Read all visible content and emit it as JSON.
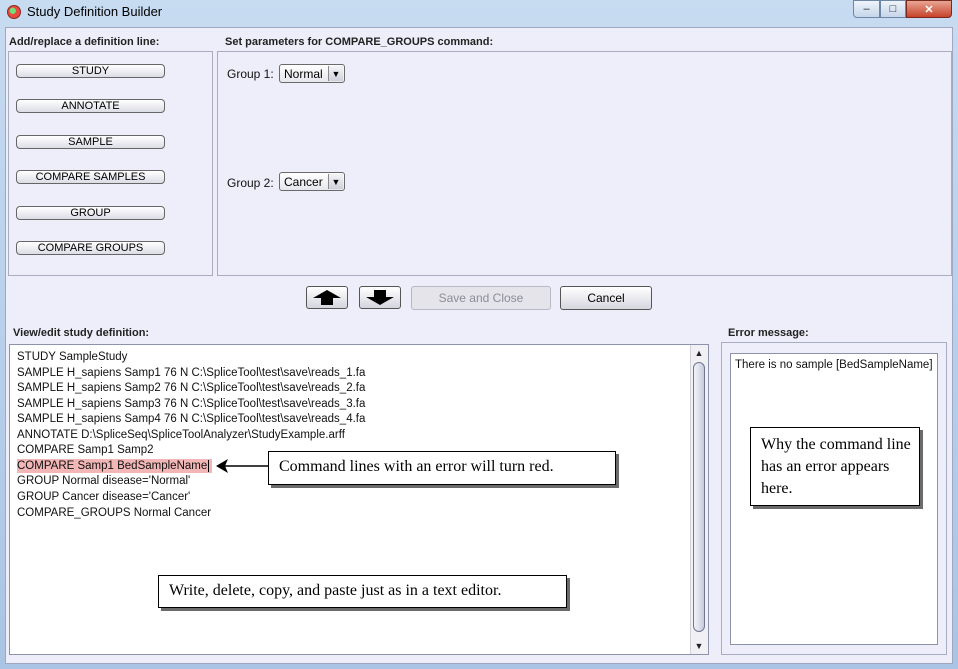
{
  "window": {
    "title": "Study Definition Builder",
    "controls": {
      "minimize": "‒",
      "maximize": "□",
      "close": "✕"
    }
  },
  "left_panel": {
    "label": "Add/replace a definition line:",
    "buttons": [
      "STUDY",
      "ANNOTATE",
      "SAMPLE",
      "COMPARE SAMPLES",
      "GROUP",
      "COMPARE GROUPS"
    ]
  },
  "params_panel": {
    "label": "Set parameters for COMPARE_GROUPS command:",
    "group1": {
      "label": "Group 1:",
      "value": "Normal"
    },
    "group2": {
      "label": "Group 2:",
      "value": "Cancer"
    }
  },
  "actions": {
    "move_up": "up-arrow",
    "move_down": "down-arrow",
    "save_label": "Save and Close",
    "save_enabled": false,
    "cancel_label": "Cancel"
  },
  "editor": {
    "label": "View/edit study definition:",
    "lines": [
      "STUDY SampleStudy",
      "SAMPLE H_sapiens Samp1 76 N C:\\SpliceTool\\test\\save\\reads_1.fa",
      "SAMPLE H_sapiens Samp2 76 N C:\\SpliceTool\\test\\save\\reads_2.fa",
      "SAMPLE H_sapiens Samp3 76 N C:\\SpliceTool\\test\\save\\reads_3.fa",
      "SAMPLE H_sapiens Samp4 76 N C:\\SpliceTool\\test\\save\\reads_4.fa",
      "ANNOTATE D:\\SpliceSeq\\SpliceToolAnalyzer\\StudyExample.arff",
      "COMPARE Samp1 Samp2",
      "COMPARE Samp1 BedSampleName",
      "GROUP Normal disease='Normal'",
      "GROUP Cancer disease='Cancer'",
      "COMPARE_GROUPS Normal Cancer"
    ],
    "error_line_index": 7,
    "error_color": "#f2b6b6"
  },
  "error_panel": {
    "label": "Error message:",
    "message": "There is no sample [BedSampleName]"
  },
  "callouts": {
    "error_line": "Command lines  with  an  error  will  turn  red.",
    "editing": "Write,  delete,  copy, and paste just as in  a text editor.",
    "error_message": "Why the command line  has an error appears here."
  }
}
